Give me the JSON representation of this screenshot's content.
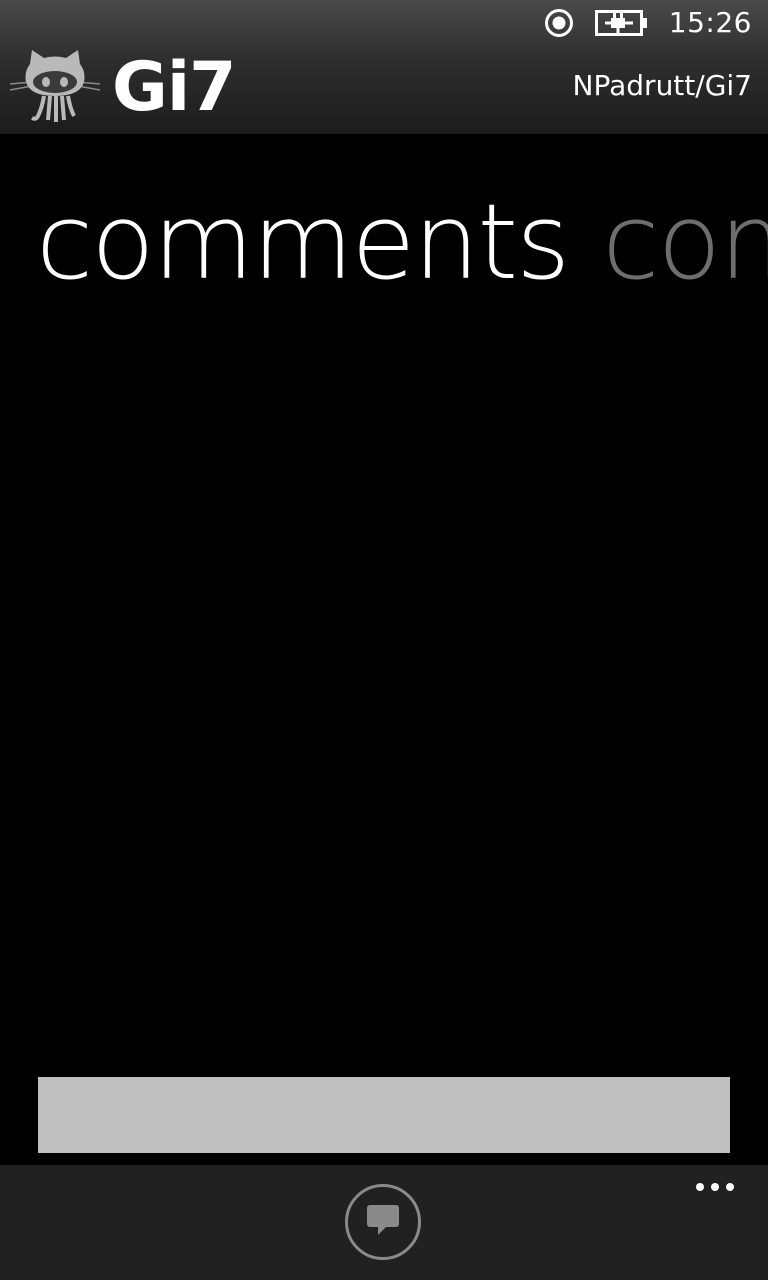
{
  "status_bar": {
    "time": "15:26",
    "icons": [
      "radio-record-icon",
      "battery-charging-icon"
    ]
  },
  "header": {
    "app_name": "Gi7",
    "repository": "NPadrutt/Gi7",
    "logo_icon": "octocat-logo"
  },
  "pivot": {
    "items": [
      {
        "label": "comments",
        "active": true
      },
      {
        "label": "com",
        "active": false
      }
    ]
  },
  "comment_box": {
    "value": "",
    "placeholder": ""
  },
  "app_bar": {
    "primary_button_icon": "comment-icon",
    "more_icon": "ellipsis-icon"
  },
  "colors": {
    "background": "#000000",
    "input_background": "#bfbfbf",
    "app_bar_background": "#212121",
    "pivot_inactive": "#6e6e6e",
    "button_ring": "#8a8a8a"
  }
}
